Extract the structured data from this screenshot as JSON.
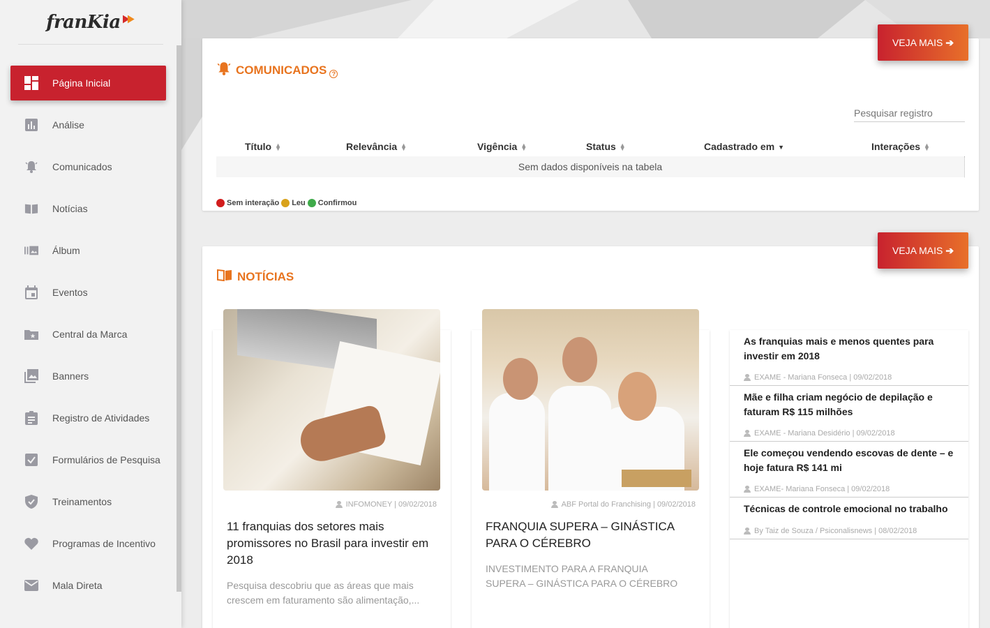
{
  "brand": {
    "name": "franKia"
  },
  "sidebar": {
    "items": [
      {
        "label": "Página Inicial",
        "icon": "dashboard-icon",
        "active": true
      },
      {
        "label": "Análise",
        "icon": "bar-chart-icon"
      },
      {
        "label": "Comunicados",
        "icon": "bell-icon"
      },
      {
        "label": "Notícias",
        "icon": "book-icon"
      },
      {
        "label": "Álbum",
        "icon": "album-icon"
      },
      {
        "label": "Eventos",
        "icon": "calendar-icon"
      },
      {
        "label": "Central da Marca",
        "icon": "folder-star-icon"
      },
      {
        "label": "Banners",
        "icon": "image-icon"
      },
      {
        "label": "Registro de Atividades",
        "icon": "clipboard-icon"
      },
      {
        "label": "Formulários de Pesquisa",
        "icon": "checkbox-icon"
      },
      {
        "label": "Treinamentos",
        "icon": "shield-check-icon"
      },
      {
        "label": "Programas de Incentivo",
        "icon": "heart-icon"
      },
      {
        "label": "Mala Direta",
        "icon": "mail-icon"
      }
    ]
  },
  "comunicados": {
    "title": "COMUNICADOS",
    "help": "?",
    "veja_mais": "VEJA MAIS",
    "search_placeholder": "Pesquisar registro",
    "columns": [
      "Título",
      "Relevância",
      "Vigência",
      "Status",
      "Cadastrado em",
      "Interações"
    ],
    "empty": "Sem dados disponíveis na tabela",
    "legend": [
      {
        "label": "Sem interação",
        "color": "#d21d1d"
      },
      {
        "label": "Leu",
        "color": "#d9a21b"
      },
      {
        "label": "Confirmou",
        "color": "#3faa4a"
      }
    ]
  },
  "noticias": {
    "title": "NOTÍCIAS",
    "veja_mais": "VEJA MAIS",
    "cards": [
      {
        "meta": "INFOMONEY | 09/02/2018",
        "title": "11 franquias dos setores mais promissores no Brasil para investir em 2018",
        "desc": "Pesquisa descobriu que as áreas que mais crescem em faturamento são alimentação,..."
      },
      {
        "meta": "ABF Portal do Franchising | 09/02/2018",
        "title": "FRANQUIA SUPERA – GINÁSTICA PARA O CÉREBRO",
        "desc": "INVESTIMENTO PARA A FRANQUIA SUPERA – GINÁSTICA PARA O CÉREBRO"
      }
    ],
    "list": [
      {
        "title": "As franquias mais e menos quentes para investir em 2018",
        "meta": "EXAME - Mariana Fonseca | 09/02/2018"
      },
      {
        "title": "Mãe e filha criam negócio de depilação e faturam R$ 115 milhões",
        "meta": "EXAME - Mariana Desidério | 09/02/2018"
      },
      {
        "title": "Ele começou vendendo escovas de dente – e hoje fatura R$ 141 mi",
        "meta": "EXAME- Mariana Fonseca | 09/02/2018"
      },
      {
        "title": "Técnicas de controle emocional no trabalho",
        "meta": "By Taiz de Souza / Psiconalisnews | 08/02/2018"
      }
    ]
  },
  "colors": {
    "accent": "#e8741f",
    "active": "#c8222e"
  }
}
